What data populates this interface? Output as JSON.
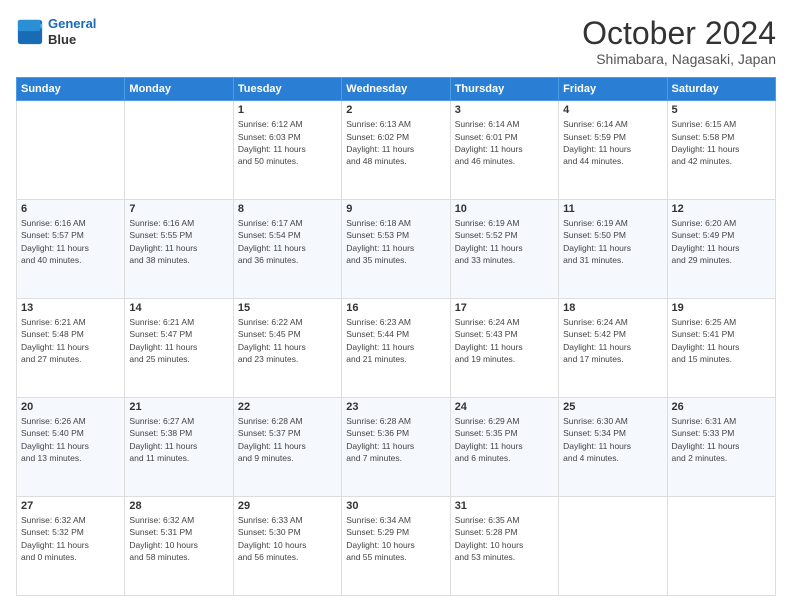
{
  "logo": {
    "line1": "General",
    "line2": "Blue"
  },
  "header": {
    "title": "October 2024",
    "subtitle": "Shimabara, Nagasaki, Japan"
  },
  "weekdays": [
    "Sunday",
    "Monday",
    "Tuesday",
    "Wednesday",
    "Thursday",
    "Friday",
    "Saturday"
  ],
  "weeks": [
    [
      {
        "day": "",
        "info": ""
      },
      {
        "day": "",
        "info": ""
      },
      {
        "day": "1",
        "info": "Sunrise: 6:12 AM\nSunset: 6:03 PM\nDaylight: 11 hours\nand 50 minutes."
      },
      {
        "day": "2",
        "info": "Sunrise: 6:13 AM\nSunset: 6:02 PM\nDaylight: 11 hours\nand 48 minutes."
      },
      {
        "day": "3",
        "info": "Sunrise: 6:14 AM\nSunset: 6:01 PM\nDaylight: 11 hours\nand 46 minutes."
      },
      {
        "day": "4",
        "info": "Sunrise: 6:14 AM\nSunset: 5:59 PM\nDaylight: 11 hours\nand 44 minutes."
      },
      {
        "day": "5",
        "info": "Sunrise: 6:15 AM\nSunset: 5:58 PM\nDaylight: 11 hours\nand 42 minutes."
      }
    ],
    [
      {
        "day": "6",
        "info": "Sunrise: 6:16 AM\nSunset: 5:57 PM\nDaylight: 11 hours\nand 40 minutes."
      },
      {
        "day": "7",
        "info": "Sunrise: 6:16 AM\nSunset: 5:55 PM\nDaylight: 11 hours\nand 38 minutes."
      },
      {
        "day": "8",
        "info": "Sunrise: 6:17 AM\nSunset: 5:54 PM\nDaylight: 11 hours\nand 36 minutes."
      },
      {
        "day": "9",
        "info": "Sunrise: 6:18 AM\nSunset: 5:53 PM\nDaylight: 11 hours\nand 35 minutes."
      },
      {
        "day": "10",
        "info": "Sunrise: 6:19 AM\nSunset: 5:52 PM\nDaylight: 11 hours\nand 33 minutes."
      },
      {
        "day": "11",
        "info": "Sunrise: 6:19 AM\nSunset: 5:50 PM\nDaylight: 11 hours\nand 31 minutes."
      },
      {
        "day": "12",
        "info": "Sunrise: 6:20 AM\nSunset: 5:49 PM\nDaylight: 11 hours\nand 29 minutes."
      }
    ],
    [
      {
        "day": "13",
        "info": "Sunrise: 6:21 AM\nSunset: 5:48 PM\nDaylight: 11 hours\nand 27 minutes."
      },
      {
        "day": "14",
        "info": "Sunrise: 6:21 AM\nSunset: 5:47 PM\nDaylight: 11 hours\nand 25 minutes."
      },
      {
        "day": "15",
        "info": "Sunrise: 6:22 AM\nSunset: 5:45 PM\nDaylight: 11 hours\nand 23 minutes."
      },
      {
        "day": "16",
        "info": "Sunrise: 6:23 AM\nSunset: 5:44 PM\nDaylight: 11 hours\nand 21 minutes."
      },
      {
        "day": "17",
        "info": "Sunrise: 6:24 AM\nSunset: 5:43 PM\nDaylight: 11 hours\nand 19 minutes."
      },
      {
        "day": "18",
        "info": "Sunrise: 6:24 AM\nSunset: 5:42 PM\nDaylight: 11 hours\nand 17 minutes."
      },
      {
        "day": "19",
        "info": "Sunrise: 6:25 AM\nSunset: 5:41 PM\nDaylight: 11 hours\nand 15 minutes."
      }
    ],
    [
      {
        "day": "20",
        "info": "Sunrise: 6:26 AM\nSunset: 5:40 PM\nDaylight: 11 hours\nand 13 minutes."
      },
      {
        "day": "21",
        "info": "Sunrise: 6:27 AM\nSunset: 5:38 PM\nDaylight: 11 hours\nand 11 minutes."
      },
      {
        "day": "22",
        "info": "Sunrise: 6:28 AM\nSunset: 5:37 PM\nDaylight: 11 hours\nand 9 minutes."
      },
      {
        "day": "23",
        "info": "Sunrise: 6:28 AM\nSunset: 5:36 PM\nDaylight: 11 hours\nand 7 minutes."
      },
      {
        "day": "24",
        "info": "Sunrise: 6:29 AM\nSunset: 5:35 PM\nDaylight: 11 hours\nand 6 minutes."
      },
      {
        "day": "25",
        "info": "Sunrise: 6:30 AM\nSunset: 5:34 PM\nDaylight: 11 hours\nand 4 minutes."
      },
      {
        "day": "26",
        "info": "Sunrise: 6:31 AM\nSunset: 5:33 PM\nDaylight: 11 hours\nand 2 minutes."
      }
    ],
    [
      {
        "day": "27",
        "info": "Sunrise: 6:32 AM\nSunset: 5:32 PM\nDaylight: 11 hours\nand 0 minutes."
      },
      {
        "day": "28",
        "info": "Sunrise: 6:32 AM\nSunset: 5:31 PM\nDaylight: 10 hours\nand 58 minutes."
      },
      {
        "day": "29",
        "info": "Sunrise: 6:33 AM\nSunset: 5:30 PM\nDaylight: 10 hours\nand 56 minutes."
      },
      {
        "day": "30",
        "info": "Sunrise: 6:34 AM\nSunset: 5:29 PM\nDaylight: 10 hours\nand 55 minutes."
      },
      {
        "day": "31",
        "info": "Sunrise: 6:35 AM\nSunset: 5:28 PM\nDaylight: 10 hours\nand 53 minutes."
      },
      {
        "day": "",
        "info": ""
      },
      {
        "day": "",
        "info": ""
      }
    ]
  ]
}
